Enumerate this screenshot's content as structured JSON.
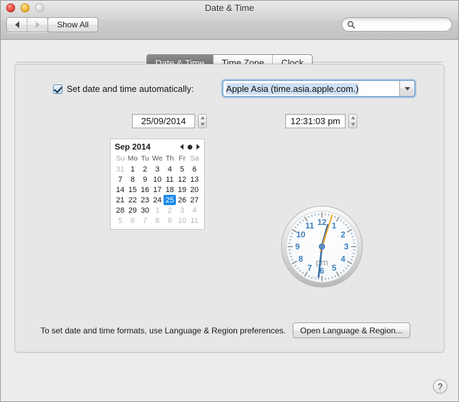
{
  "window": {
    "title": "Date & Time",
    "traffic_lights": [
      "close-button",
      "minimize-button",
      "zoom-button"
    ]
  },
  "toolbar": {
    "back_label": "",
    "forward_label": "",
    "show_all_label": "Show All",
    "search": {
      "value": "",
      "placeholder": "",
      "icon": "search-icon"
    }
  },
  "tabs": [
    {
      "label": "Date & Time",
      "selected": true
    },
    {
      "label": "Time Zone",
      "selected": false
    },
    {
      "label": "Clock",
      "selected": false
    }
  ],
  "main": {
    "auto_set": {
      "checked": true,
      "label": "Set date and time automatically:",
      "server_value": "Apple Asia (time.asia.apple.com.)"
    },
    "date_field": {
      "value": "25/09/2014"
    },
    "time_field": {
      "value": "12:31:03 pm"
    },
    "calendar": {
      "title": "Sep 2014",
      "prev_icon": "chevron-left-icon",
      "today_icon": "today-dot-icon",
      "next_icon": "chevron-right-icon",
      "weekdays": [
        "Su",
        "Mo",
        "Tu",
        "We",
        "Th",
        "Fr",
        "Sa"
      ],
      "weekend_indices": [
        0,
        6
      ],
      "selected_day": 25,
      "weeks": [
        [
          {
            "d": "31",
            "out": true
          },
          {
            "d": "1"
          },
          {
            "d": "2"
          },
          {
            "d": "3"
          },
          {
            "d": "4"
          },
          {
            "d": "5"
          },
          {
            "d": "6"
          }
        ],
        [
          {
            "d": "7"
          },
          {
            "d": "8"
          },
          {
            "d": "9"
          },
          {
            "d": "10"
          },
          {
            "d": "11"
          },
          {
            "d": "12"
          },
          {
            "d": "13"
          }
        ],
        [
          {
            "d": "14"
          },
          {
            "d": "15"
          },
          {
            "d": "16"
          },
          {
            "d": "17"
          },
          {
            "d": "18"
          },
          {
            "d": "19"
          },
          {
            "d": "20"
          }
        ],
        [
          {
            "d": "21"
          },
          {
            "d": "22"
          },
          {
            "d": "23"
          },
          {
            "d": "24"
          },
          {
            "d": "25",
            "sel": true
          },
          {
            "d": "26"
          },
          {
            "d": "27"
          }
        ],
        [
          {
            "d": "28"
          },
          {
            "d": "29"
          },
          {
            "d": "30"
          },
          {
            "d": "1",
            "out": true
          },
          {
            "d": "2",
            "out": true
          },
          {
            "d": "3",
            "out": true
          },
          {
            "d": "4",
            "out": true
          }
        ],
        [
          {
            "d": "5",
            "out": true
          },
          {
            "d": "6",
            "out": true
          },
          {
            "d": "7",
            "out": true
          },
          {
            "d": "8",
            "out": true
          },
          {
            "d": "9",
            "out": true
          },
          {
            "d": "10",
            "out": true
          },
          {
            "d": "11",
            "out": true
          }
        ]
      ]
    },
    "clock": {
      "meridiem": "pm",
      "numerals": [
        "1",
        "2",
        "3",
        "4",
        "5",
        "6",
        "7",
        "8",
        "9",
        "10",
        "11",
        "12"
      ],
      "hour": 12,
      "minute": 31,
      "second": 3,
      "numeral_color": "#3e7fbf",
      "second_hand_color": "#f0a72b",
      "hand_color": "#3a6ea5"
    },
    "footer": {
      "text": "To set date and time formats, use Language & Region preferences.",
      "button_label": "Open Language & Region..."
    },
    "help_label": "?"
  },
  "colors": {
    "accent": "#1e8bec",
    "window_bg": "#ececec",
    "panel_bg": "#e7e7e7",
    "focus_ring": "#6ea8de"
  }
}
